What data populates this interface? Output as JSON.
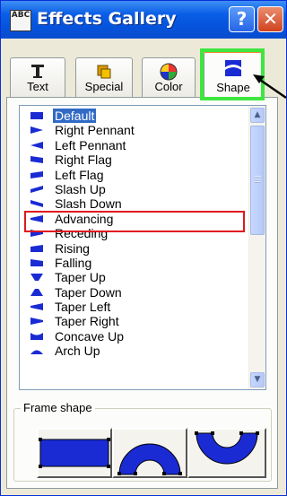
{
  "window": {
    "title": "Effects Gallery",
    "app_icon_text": "ABC",
    "help_button": "?",
    "close_button": "✕"
  },
  "tabs": [
    {
      "label": "Text",
      "icon": "text-icon"
    },
    {
      "label": "Special",
      "icon": "special-icon"
    },
    {
      "label": "Color",
      "icon": "color-wheel-icon"
    },
    {
      "label": "Shape",
      "icon": "shape-icon",
      "active": true
    }
  ],
  "shape_list": {
    "selected": "Default",
    "items": [
      "Default",
      "Right Pennant",
      "Left Pennant",
      "Right Flag",
      "Left Flag",
      "Slash Up",
      "Slash Down",
      "Advancing",
      "Receding",
      "Rising",
      "Falling",
      "Taper Up",
      "Taper Down",
      "Taper Left",
      "Taper Right",
      "Concave Up",
      "Arch Up"
    ]
  },
  "frame_shape": {
    "label": "Frame shape",
    "options": [
      "rectangle-frame",
      "arch-frame",
      "bowl-frame"
    ]
  },
  "colors": {
    "title_bar": "#0553dc",
    "selection": "#316ac5",
    "highlight_green": "#3ee63e",
    "highlight_red": "#e0181f",
    "shape_blue": "#1a2bd4"
  }
}
